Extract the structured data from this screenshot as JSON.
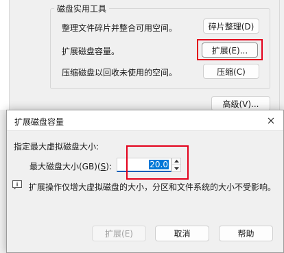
{
  "background_window": {
    "group_title": "磁盘实用工具",
    "rows": [
      {
        "label": "整理文件碎片并整合可用空间。",
        "button": "碎片整理(D)"
      },
      {
        "label": "扩展磁盘容量。",
        "button": "扩展(E)..."
      },
      {
        "label": "压缩磁盘以回收未使用的空间。",
        "button": "压缩(C)"
      }
    ],
    "advanced_button": "高级(V)..."
  },
  "dialog": {
    "title": "扩展磁盘容量",
    "section_label": "指定最大虚拟磁盘大小:",
    "size_label_prefix": "最大磁盘大小(GB)(",
    "size_label_key": "S",
    "size_label_suffix": "):",
    "size_value": "20.0",
    "info_text": "扩展操作仅增大虚拟磁盘的大小，分区和文件系统的大小不受影响。",
    "buttons": {
      "expand": "扩展(E)",
      "cancel": "取消",
      "help": "帮助"
    }
  },
  "colors": {
    "highlight_red": "#e3001b",
    "selection_blue": "#0078d7",
    "focus_underline": "#005fb8"
  },
  "icons": [
    "close-icon",
    "info-icon",
    "spin-up-icon",
    "spin-down-icon"
  ]
}
